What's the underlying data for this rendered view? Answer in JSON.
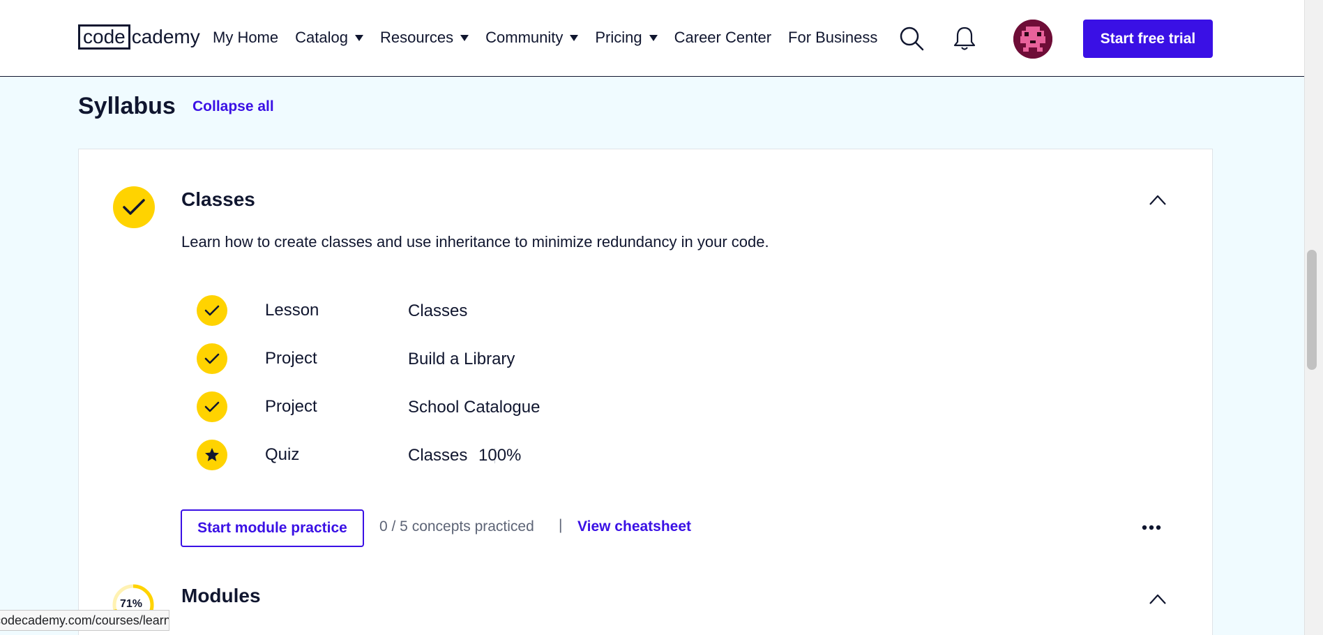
{
  "nav": {
    "logo_box": "code",
    "logo_rest": "cademy",
    "items": [
      {
        "label": "My Home",
        "dropdown": false
      },
      {
        "label": "Catalog",
        "dropdown": true
      },
      {
        "label": "Resources",
        "dropdown": true
      },
      {
        "label": "Community",
        "dropdown": true
      },
      {
        "label": "Pricing",
        "dropdown": true
      },
      {
        "label": "Career Center",
        "dropdown": false
      },
      {
        "label": "For Business",
        "dropdown": false
      }
    ],
    "icons": [
      "search-icon",
      "bell-icon",
      "avatar"
    ],
    "cta_label": "Start free trial"
  },
  "syllabus": {
    "title": "Syllabus",
    "collapse_label": "Collapse all"
  },
  "module": {
    "title": "Classes",
    "description": "Learn how to create classes and use inheritance to minimize redundancy in your code.",
    "items": [
      {
        "type": "Lesson",
        "name": "Classes",
        "status": "complete"
      },
      {
        "type": "Project",
        "name": "Build a Library",
        "status": "complete"
      },
      {
        "type": "Project",
        "name": "School Catalogue",
        "status": "complete"
      },
      {
        "type": "Quiz",
        "name": "Classes",
        "score": "100%",
        "status": "star"
      }
    ],
    "practice_label": "Start module practice",
    "concepts_text": "0 / 5 concepts practiced",
    "divider": "|",
    "cheatsheet_label": "View cheatsheet"
  },
  "next_module": {
    "title": "Modules",
    "progress_label": "71%",
    "progress": 0.71
  },
  "statusbar": {
    "url": "codecademy.com/courses/learn"
  },
  "colors": {
    "accent": "#3a10e5",
    "complete": "#ffd300",
    "text": "#10162f",
    "page_bg": "#f0fbff"
  }
}
